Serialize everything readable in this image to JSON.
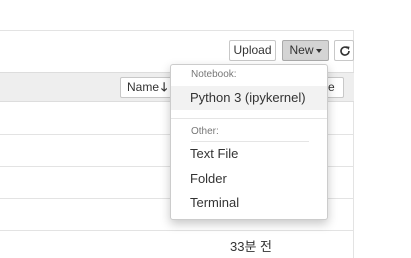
{
  "toolbar": {
    "upload_label": "Upload",
    "new_label": "New",
    "refresh_icon": "refresh-icon"
  },
  "list_header": {
    "sort_name_label": "Name",
    "sort_arrow": "🡓",
    "sort_tail_label": "ze"
  },
  "rows": [
    {
      "modified": "33분 전"
    }
  ],
  "new_menu": {
    "notebook_header": "Notebook:",
    "notebook_items": [
      "Python 3 (ipykernel)"
    ],
    "other_header": "Other:",
    "other_items": [
      "Text File",
      "Folder",
      "Terminal"
    ]
  },
  "colors": {
    "menu_active_bg": "#f2f2f2",
    "new_button_bg": "#d4d4d4"
  }
}
